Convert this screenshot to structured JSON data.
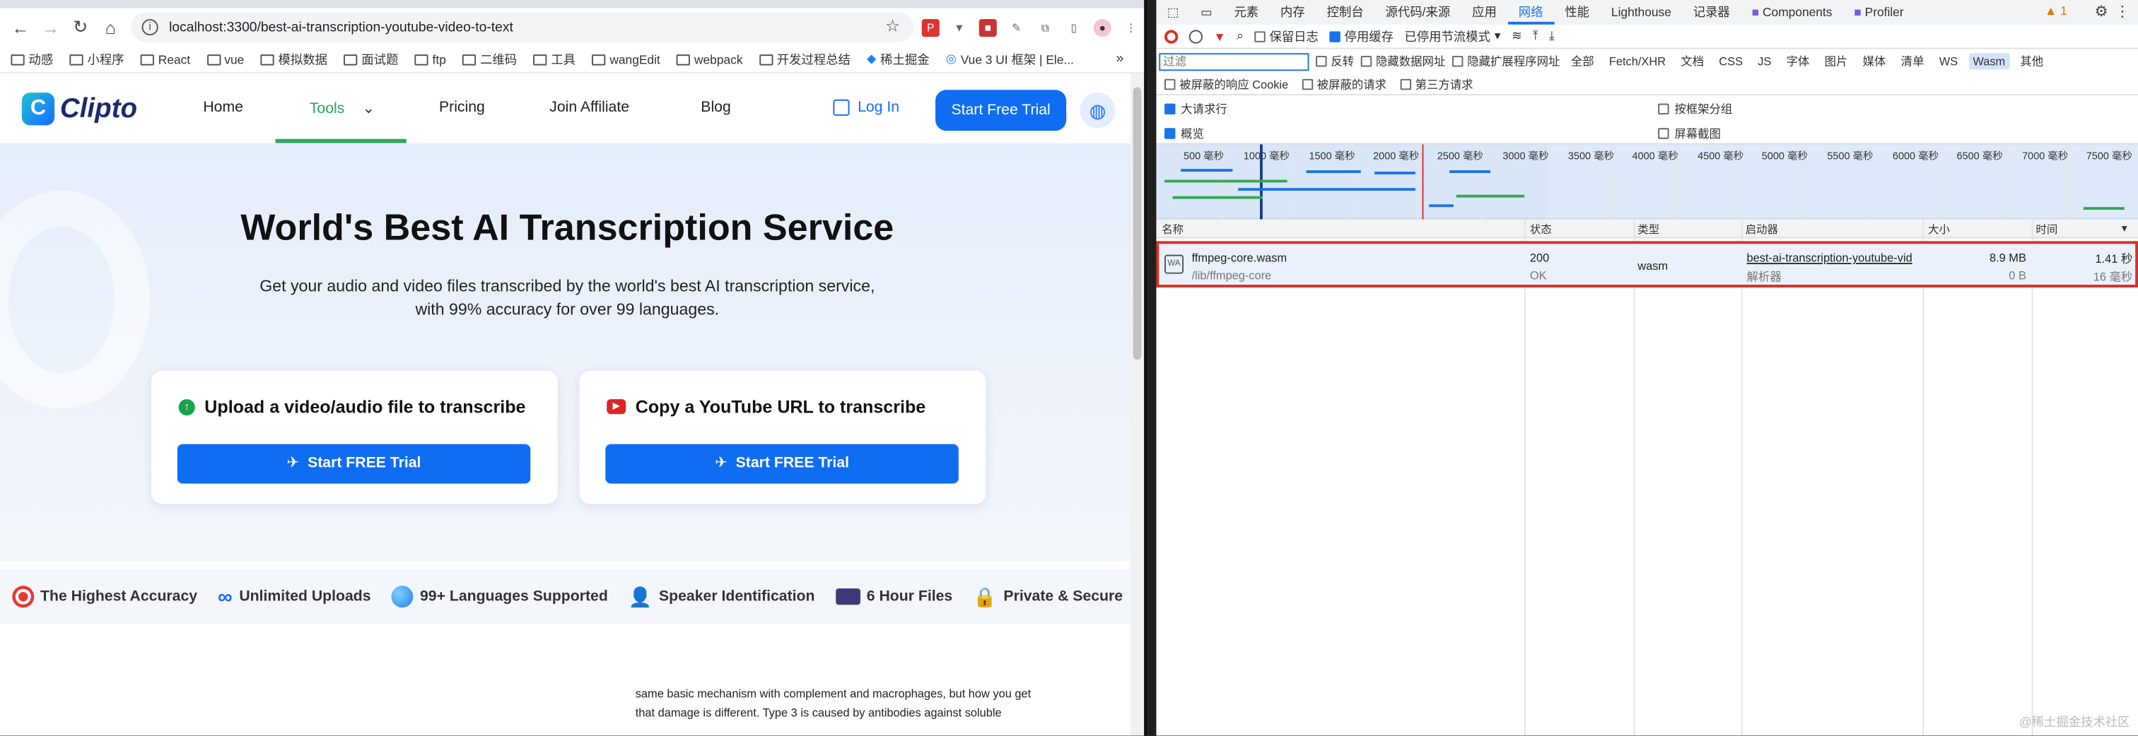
{
  "browser": {
    "url": "localhost:3300/best-ai-transcription-youtube-video-to-text",
    "bookmarks": [
      "动感",
      "小程序",
      "React",
      "vue",
      "模拟数据",
      "面试题",
      "ftp",
      "二维码",
      "工具",
      "wangEdit",
      "webpack",
      "开发过程总结",
      "稀土掘金",
      "Vue 3 UI 框架 | Ele..."
    ],
    "bookmark_more": "»"
  },
  "site": {
    "brand": "Clipto",
    "nav": {
      "home": "Home",
      "tools": "Tools",
      "pricing": "Pricing",
      "affiliate": "Join Affiliate",
      "blog": "Blog",
      "login": "Log In",
      "trial": "Start Free Trial"
    },
    "hero": {
      "title": "World's Best AI Transcription Service",
      "subtitle": "Get your audio and video files transcribed by the world's best AI transcription service, with 99% accuracy for over 99 languages."
    },
    "cards": [
      {
        "title": "Upload a video/audio file to transcribe",
        "button": "Start FREE Trial"
      },
      {
        "title": "Copy a YouTube URL to transcribe",
        "button": "Start FREE Trial"
      }
    ],
    "features": [
      "The Highest Accuracy",
      "Unlimited Uploads",
      "99+ Languages Supported",
      "Speaker Identification",
      "6 Hour Files",
      "Private & Secure"
    ],
    "body_faded": "",
    "body_line1": "same basic mechanism with complement and macrophages, but how you get",
    "body_line2": "that damage is different. Type 3 is caused by antibodies against soluble"
  },
  "devtools": {
    "tabs": [
      "元素",
      "内存",
      "控制台",
      "源代码/来源",
      "应用",
      "网络",
      "性能",
      "Lighthouse",
      "记录器",
      "Components",
      "Profiler"
    ],
    "active_tab": "网络",
    "warning_count": "1",
    "toolbar": {
      "preserve_log": "保留日志",
      "disable_cache": "停用缓存",
      "throttle": "已停用节流模式"
    },
    "filter": {
      "placeholder": "过滤",
      "invert": "反转",
      "hide_data_urls": "隐藏数据网址",
      "hide_ext_urls": "隐藏扩展程序网址",
      "types": [
        "全部",
        "Fetch/XHR",
        "文档",
        "CSS",
        "JS",
        "字体",
        "图片",
        "媒体",
        "清单",
        "WS",
        "Wasm",
        "其他"
      ],
      "selected_type": "Wasm"
    },
    "options": {
      "blocked_cookies": "被屏蔽的响应 Cookie",
      "blocked_requests": "被屏蔽的请求",
      "third_party": "第三方请求",
      "big_rows": "大请求行",
      "group_by_frame": "按框架分组",
      "overview": "概览",
      "screenshots": "屏幕截图"
    },
    "timeline_ticks": [
      "500 毫秒",
      "1000 毫秒",
      "1500 毫秒",
      "2000 毫秒",
      "2500 毫秒",
      "3000 毫秒",
      "3500 毫秒",
      "4000 毫秒",
      "4500 毫秒",
      "5000 毫秒",
      "5500 毫秒",
      "6000 毫秒",
      "6500 毫秒",
      "7000 毫秒",
      "7500 毫秒"
    ],
    "columns": {
      "name": "名称",
      "status": "状态",
      "type": "类型",
      "initiator": "启动器",
      "size": "大小",
      "time": "时间"
    },
    "request": {
      "name": "ffmpeg-core.wasm",
      "path": "/lib/ffmpeg-core",
      "status": "200",
      "status_text": "OK",
      "type": "wasm",
      "initiator": "best-ai-transcription-youtube-vid",
      "initiator_sub": "解析器",
      "size": "8.9 MB",
      "size_sub": "0 B",
      "time": "1.41 秒",
      "time_sub": "16 毫秒"
    },
    "watermark": "@稀土掘金技术社区"
  },
  "colors": {
    "brand_blue": "#0f6df2",
    "active_green": "#2ba65e",
    "highlight_red": "#d93025"
  }
}
